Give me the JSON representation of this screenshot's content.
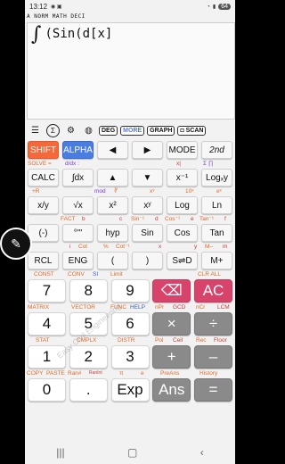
{
  "status": {
    "time": "13:12",
    "battery": "64"
  },
  "mode_bar": "A NORM MATH DECI",
  "display": {
    "integral_symbol": "∫",
    "expression": "(Sin(d[x]"
  },
  "toolbar": {
    "sigma_label": "Σ",
    "deg": "DEG",
    "more": "MORE",
    "graph": "GRAPH",
    "scan": "SCAN"
  },
  "row1": {
    "shift": "SHIFT",
    "alpha": "ALPHA",
    "left": "◀",
    "right": "▶",
    "mode": "MODE",
    "second": "2nd"
  },
  "row1_sec": {
    "solve": "SOLVE =",
    "ddx": "d/dx :",
    "x1": "x|",
    "sum": "Σ ∏"
  },
  "row2": {
    "calc": "CALC",
    "int": "∫dx",
    "up": "▲",
    "down": "▼",
    "xinv": "x⁻¹",
    "logxy": "Logₓy"
  },
  "row2_sec": {
    "a": "+R",
    "b": "mod",
    "c": "∛",
    "d": "x³",
    "e": "10ˣ",
    "f": "eˣ"
  },
  "row3": {
    "frac": "x/y",
    "sqrt": "√x",
    "x2": "x²",
    "xy": "xʸ",
    "log": "Log",
    "ln": "Ln"
  },
  "row3_sec": {
    "fact": "FACT",
    "b": "b",
    "c": "c",
    "sin1": "Sin⁻¹",
    "d": "d",
    "cos1": "Cos⁻¹",
    "e": "e",
    "tan1": "Tan⁻¹",
    "f": "f"
  },
  "row4": {
    "neg": "(-)",
    "deg": "°'\"",
    "hyp": "hyp",
    "sin": "Sin",
    "cos": "Cos",
    "tan": "Tan"
  },
  "row4_sec": {
    "i": "i",
    "cot": "Cot",
    "pct": "%",
    "cot1": "Cot⁻¹",
    "x": "x",
    "y": "y",
    "m": "M–",
    "mm": "m"
  },
  "row5": {
    "rcl": "RCL",
    "eng": "ENG",
    "lp": "(",
    "rp": ")",
    "sd": "S⇌D",
    "mplus": "M+"
  },
  "num_sec1": {
    "const": "CONST",
    "conv": "CONV",
    "si": "SI",
    "limit": "Limit",
    "clr": "CLR ALL"
  },
  "num1": {
    "k7": "7",
    "k8": "8",
    "k9": "9",
    "del": "⌫",
    "ac": "AC"
  },
  "num_sec2": {
    "matrix": "MATRIX",
    "vector": "VECTOR",
    "func": "FUNC",
    "help": "HELP",
    "npr": "nPr",
    "gcd": "GCD",
    "ncr": "nCr",
    "lcm": "LCM"
  },
  "num2": {
    "k4": "4",
    "k5": "5",
    "k6": "6",
    "mul": "×",
    "div": "÷"
  },
  "num_sec3": {
    "stat": "STAT",
    "cmplx": "CMPLX",
    "distr": "DISTR",
    "pol": "Pol",
    "ceil": "Ceil",
    "rec": "Rec",
    "floor": "Floor"
  },
  "num3": {
    "k1": "1",
    "k2": "2",
    "k3": "3",
    "plus": "+",
    "minus": "–"
  },
  "num_sec4": {
    "copy": "COPY",
    "paste": "PASTE",
    "ran": "Ran#",
    "ranint": "RanInt",
    "pi": "π",
    "e": "e",
    "preans": "PreAns",
    "history": "History"
  },
  "num4": {
    "k0": "0",
    "dot": ".",
    "exp": "Exp",
    "ans": "Ans",
    "eq": "="
  },
  "watermark": "Easy Civil Engineering"
}
